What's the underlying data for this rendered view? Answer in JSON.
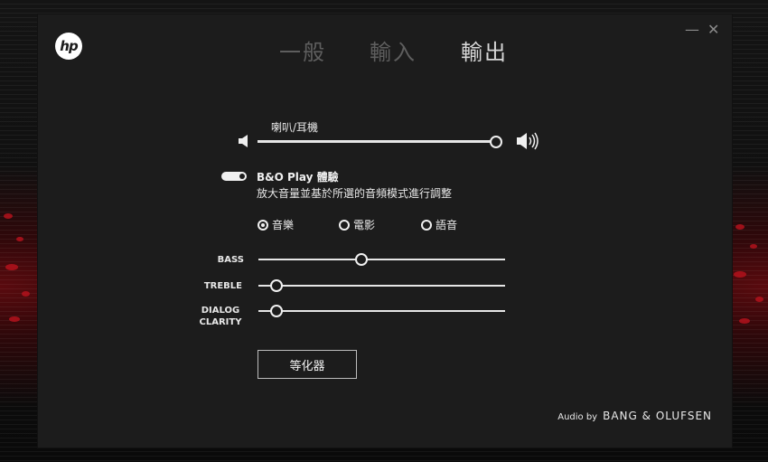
{
  "tabs": [
    {
      "label": "一般",
      "active": false
    },
    {
      "label": "輸入",
      "active": false
    },
    {
      "label": "輸出",
      "active": true
    }
  ],
  "window_controls": {
    "minimize": "—",
    "close": "✕"
  },
  "volume": {
    "label": "喇叭/耳機",
    "level": 0.99
  },
  "bo_play": {
    "title": "B&O Play 體驗",
    "description": "放大音量並基於所選的音頻模式進行調整",
    "enabled": true
  },
  "modes": [
    {
      "label": "音樂",
      "selected": true
    },
    {
      "label": "電影",
      "selected": false
    },
    {
      "label": "語音",
      "selected": false
    }
  ],
  "eq_sliders": [
    {
      "label": "BASS",
      "value": 0.42
    },
    {
      "label": "TREBLE",
      "value": 0.07
    },
    {
      "label": "DIALOG CLARITY",
      "value": 0.07
    }
  ],
  "equalizer_button": "等化器",
  "brand": {
    "prefix": "Audio by",
    "name": "BANG & OLUFSEN"
  },
  "logo": "hp",
  "colors": {
    "accent": "#f0f0f0",
    "background": "#1c1c1c",
    "inactive_tab": "#5e5e5e"
  }
}
